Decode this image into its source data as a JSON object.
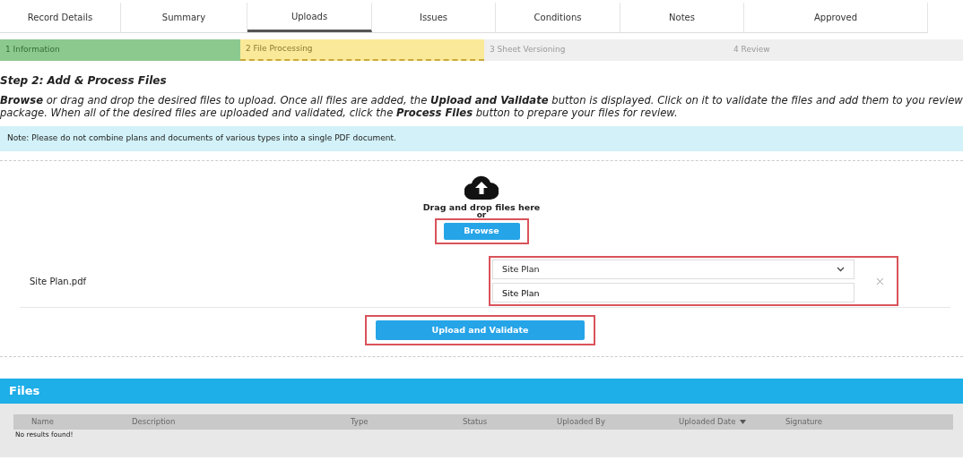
{
  "tabs": [
    {
      "label": "Record Details",
      "selected": false
    },
    {
      "label": "Summary",
      "selected": false
    },
    {
      "label": "Uploads",
      "selected": true
    },
    {
      "label": "Issues",
      "selected": false
    },
    {
      "label": "Conditions",
      "selected": false
    },
    {
      "label": "Notes",
      "selected": false
    },
    {
      "label": "Approved",
      "selected": false
    }
  ],
  "steps": [
    {
      "label": "1 Information",
      "completed": true,
      "selected": false
    },
    {
      "label": "2 File Processing",
      "completed": false,
      "selected": true
    },
    {
      "label": "3 Sheet Versioning",
      "completed": false,
      "selected": false
    },
    {
      "label": "4 Review",
      "completed": false,
      "selected": false
    }
  ],
  "heading": "Step 2: Add & Process Files",
  "instructions": "**Browse** or drag and drop the desired files to upload. Once all files are added, the **Upload and Validate** button is displayed. Click on it to validate the files and add them to you review package. When all of the desired files are uploaded and validated, click the **Process Files** button to prepare your files for review.",
  "note": "Note: Please do not combine plans and documents of various types into a single PDF document.",
  "dropzone": {
    "text": "Drag and drop files here",
    "or": "or",
    "button": "Browse",
    "highlighted": true
  },
  "file": {
    "name": "Site Plan.pdf",
    "type": "Site Plan",
    "description": "Site Plan",
    "highlighted": true
  },
  "upload_button": {
    "label": "Upload and Validate",
    "highlighted": true
  },
  "files": {
    "title": "Files",
    "columns": [
      {
        "label": "Name",
        "sorted": false
      },
      {
        "label": "Description",
        "sorted": false
      },
      {
        "label": "Type",
        "sorted": false
      },
      {
        "label": "Status",
        "sorted": false
      },
      {
        "label": "Uploaded By",
        "sorted": false
      },
      {
        "label": "Uploaded Date",
        "sorted": true
      },
      {
        "label": "Signature",
        "sorted": false
      }
    ],
    "empty": "No results found!"
  }
}
